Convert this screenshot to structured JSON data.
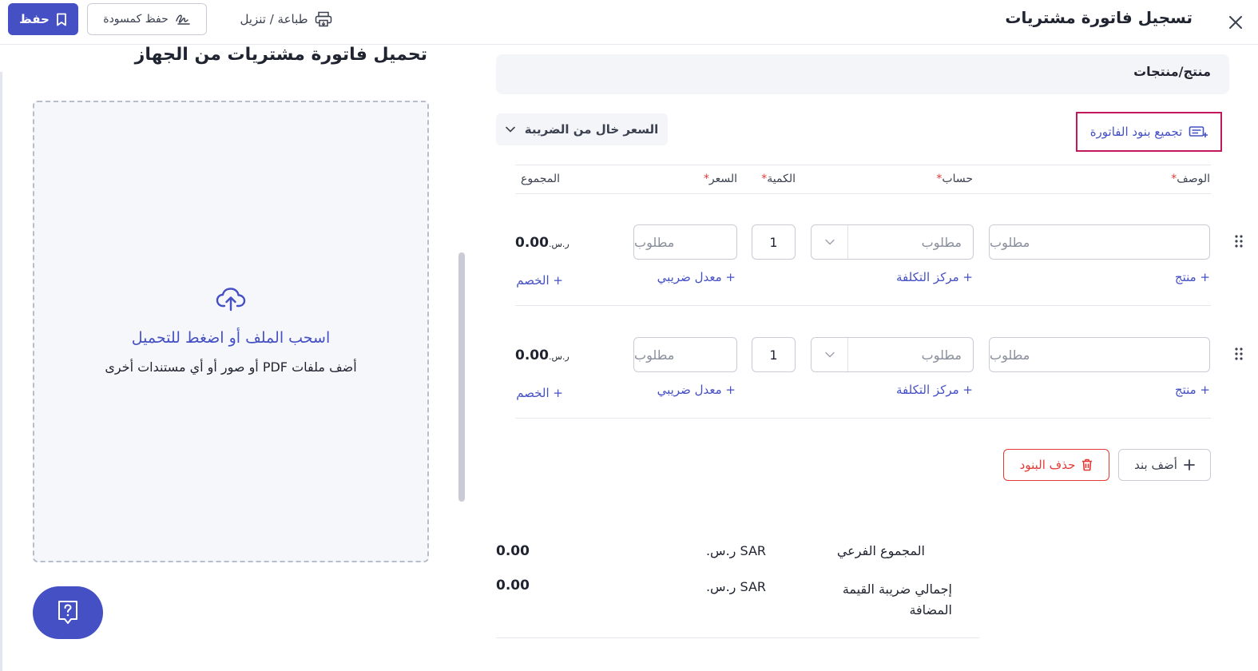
{
  "header": {
    "title": "تسجيل فاتورة مشتريات",
    "save_label": "حفظ",
    "draft_label": "حفظ كمسودة",
    "print_label": "طباعة / تنزيل"
  },
  "upload": {
    "title": "تحميل فاتورة مشتريات من الجهاز",
    "drop_main": "اسحب الملف أو اضغط للتحميل",
    "drop_sub": "أضف ملفات PDF أو صور أو أي مستندات أخرى"
  },
  "form": {
    "product_label": "منتج/منتجات",
    "group_items_label": "تجميع بنود الفاتورة",
    "tax_mode": "السعر خال من الضريبة",
    "columns": {
      "description": "الوصف",
      "account": "حساب",
      "quantity": "الكمية",
      "price": "السعر",
      "total": "المجموع",
      "required_mark": "*"
    },
    "rows": [
      {
        "description_placeholder": "مطلوب",
        "account_placeholder": "مطلوب",
        "quantity": "1",
        "price_placeholder": "مطلوب",
        "total": "0.00",
        "currency": "ر.س.",
        "add_product": "+ منتج",
        "add_cost_center": "+ مركز التكلفة",
        "add_tax_rate": "+ معدل ضريبي",
        "add_discount": "+ الخصم"
      },
      {
        "description_placeholder": "مطلوب",
        "account_placeholder": "مطلوب",
        "quantity": "1",
        "price_placeholder": "مطلوب",
        "total": "0.00",
        "currency": "ر.س.",
        "add_product": "+ منتج",
        "add_cost_center": "+ مركز التكلفة",
        "add_tax_rate": "+ معدل ضريبي",
        "add_discount": "+ الخصم"
      }
    ],
    "add_item_label": "أضف بند",
    "delete_items_label": "حذف البنود"
  },
  "summary": {
    "subtotal_label": "المجموع الفرعي",
    "subtotal_currency": "SAR ر.س.",
    "subtotal_value": "0.00",
    "vat_label_line1": "إجمالي ضريبة القيمة",
    "vat_label_line2": "المضافة",
    "vat_currency": "SAR ر.س.",
    "vat_value": "0.00"
  },
  "colors": {
    "primary": "#4450c4",
    "danger": "#e53935",
    "highlight": "#c2185b"
  },
  "icons": [
    "close-icon",
    "bookmark-icon",
    "signature-icon",
    "printer-icon",
    "upload-cloud-icon",
    "help-chat-icon",
    "group-items-icon",
    "chevron-down-icon",
    "drag-handle-icon",
    "plus-icon",
    "trash-icon"
  ]
}
